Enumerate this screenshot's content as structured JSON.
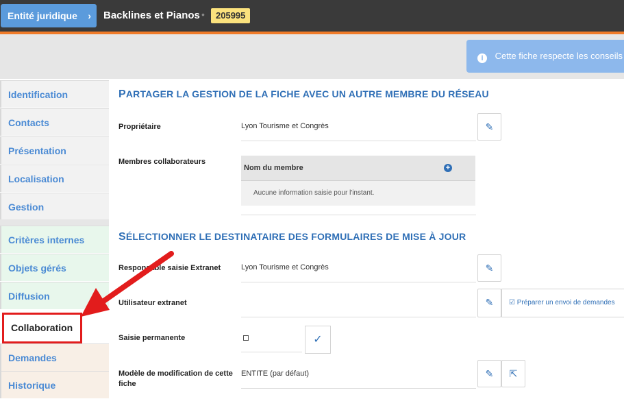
{
  "header": {
    "entity_button_label": "Entité juridique",
    "chevron": "›",
    "record_name": "Backlines et Pianos",
    "separator": "•",
    "record_id": "205995"
  },
  "info_banner": {
    "icon": "info-icon",
    "text": "Cette fiche respecte les conseils de"
  },
  "sidebar": {
    "items": [
      {
        "label": "Identification"
      },
      {
        "label": "Contacts"
      },
      {
        "label": "Présentation"
      },
      {
        "label": "Localisation"
      },
      {
        "label": "Gestion"
      },
      {
        "label": "Critères internes"
      },
      {
        "label": "Objets gérés"
      },
      {
        "label": "Diffusion"
      },
      {
        "label": "Collaboration"
      },
      {
        "label": "Demandes"
      },
      {
        "label": "Historique"
      }
    ],
    "active": "Collaboration"
  },
  "section1": {
    "title_first": "P",
    "title_rest": "ARTAGER LA GESTION DE LA FICHE AVEC UN AUTRE MEMBRE DU RÉSEAU",
    "owner_label": "Propriétaire",
    "owner_value": "Lyon Tourisme et Congrès",
    "members_label": "Membres collaborateurs",
    "members_table": {
      "column_header": "Nom du membre",
      "add_icon": "+",
      "empty_text": "Aucune information saisie pour l'instant."
    }
  },
  "section2": {
    "title_first": "S",
    "title_rest": "ÉLECTIONNER LE DESTINATAIRE DES FORMULAIRES DE MISE À JOUR",
    "responsable_label": "Responsable saisie Extranet",
    "responsable_value": "Lyon Tourisme et Congrès",
    "utilisateur_label": "Utilisateur extranet",
    "utilisateur_value": "",
    "prepare_button": "Préparer un envoi de demandes",
    "saisie_label": "Saisie permanente",
    "modele_label_line1": "Modèle de modification de cette",
    "modele_label_line2": "fiche",
    "modele_value": "ENTITE (par défaut)"
  },
  "icons": {
    "edit": "✎",
    "check": "✓",
    "external": "⇱"
  },
  "colors": {
    "topbar": "#3a3a3a",
    "accent": "#f07b29",
    "link": "#4a8ad4",
    "title": "#2f6fb6",
    "badge": "#fbe27d",
    "highlight": "#e21c1c"
  }
}
